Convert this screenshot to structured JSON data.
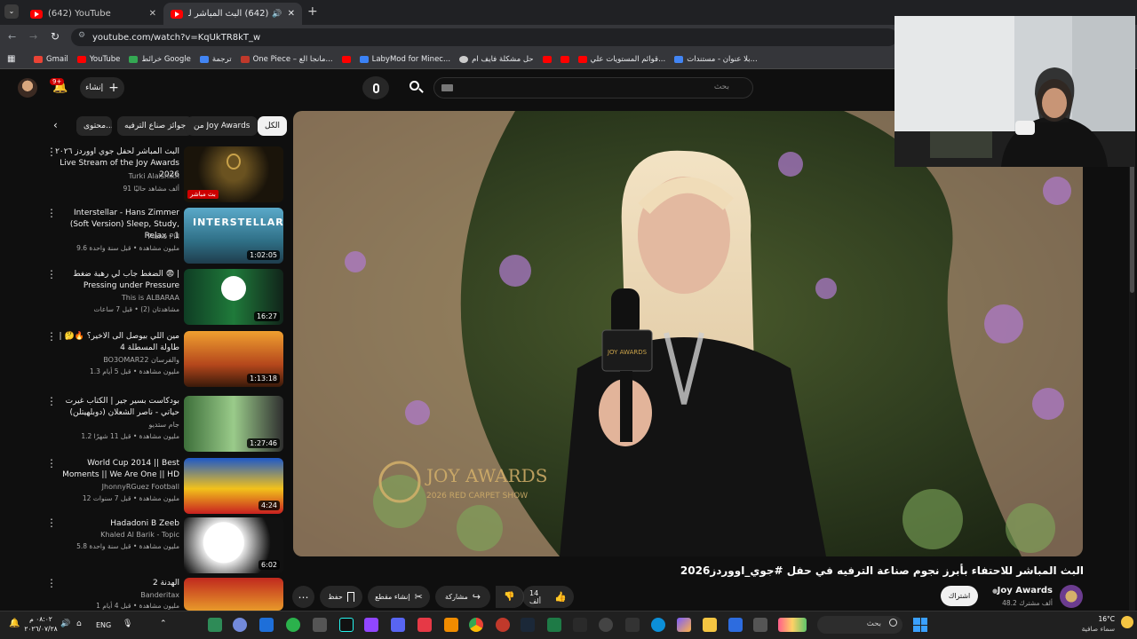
{
  "browser": {
    "tabs": [
      {
        "title": "(642) YouTube"
      },
      {
        "title": "(642) البث المباشر للاحتفاء بأ..."
      }
    ],
    "url": "youtube.com/watch?v=KqUkTR8kT_w",
    "bookmarks": [
      {
        "label": "Gmail",
        "color": "#ea4335"
      },
      {
        "label": "YouTube",
        "color": "#ff0000"
      },
      {
        "label": "خرائط Google",
        "color": "#34a853"
      },
      {
        "label": "ترجمة",
        "color": "#4285f4"
      },
      {
        "label": "One Piece – مانجا الع...",
        "color": "#c0392b"
      },
      {
        "label": "",
        "color": "#ff0000"
      },
      {
        "label": "LabyMod for Minec...",
        "color": "#3b82f6"
      },
      {
        "label": "حل مشكلة فايف ام",
        "color": "#cccccc"
      },
      {
        "label": "",
        "color": "#ff0000"
      },
      {
        "label": "",
        "color": "#ff0000"
      },
      {
        "label": "قوائم المستويات علي...",
        "color": "#ff0000"
      },
      {
        "label": "بلا عنوان - مستندات...",
        "color": "#4285f4"
      }
    ]
  },
  "header": {
    "create_label": "إنشاء",
    "notif_count": "9+",
    "search_placeholder": "بحث"
  },
  "chips": [
    "الكل",
    "من Joy Awards",
    "جوائز صناع الترفيه",
    "محتوى..."
  ],
  "recommendations": [
    {
      "title": "البث المباشر لحفل جوي اووردز ٢٠٢٦ Live Stream of the Joy Awards 2026",
      "channel": "Turki Alalshikh",
      "meta": "91 ألف مشاهد حاليًا",
      "duration": "",
      "badge": "بث مباشر"
    },
    {
      "title": "Interstellar - Hans Zimmer (Soft Version) Sleep, Study, Relax - 1",
      "channel": "Piano Pill",
      "meta": "9.6 مليون مشاهدة • قبل سنة واحدة",
      "duration": "1:02:05",
      "badge": ""
    },
    {
      "title": "الضغط جاب لي رهبة ضغط 😨 | Pressing under Pressure",
      "channel": "This is ALBARAA",
      "meta": "مشاهدتان (2) • قبل 7 ساعات",
      "duration": "16:27",
      "badge": ""
    },
    {
      "title": "مين اللي بيوصل الى الاخير؟ 🔥🤔 | طاولة المسطلة 4",
      "channel": "BO3OMAR22 والفرسان",
      "meta": "1.3 مليون مشاهدة • قبل 5 أيام",
      "duration": "1:13:18",
      "badge": ""
    },
    {
      "title": "بودكاست بسير جير | الكتاب غيرت حياتي - ناصر الشعلان (دوبلهيتلن)",
      "channel": "جام ستديو",
      "meta": "1.2 مليون مشاهدة • قبل 11 شهرًا",
      "duration": "1:27:46",
      "badge": ""
    },
    {
      "title": "World Cup 2014 || Best Moments || We Are One || HD",
      "channel": "JhonnyRGuez Football",
      "meta": "12 مليون مشاهدة • قبل 7 سنوات",
      "duration": "4:24",
      "badge": ""
    },
    {
      "title": "Hadadoni B Zeeb",
      "channel": "Khaled Al Barik - Topic",
      "meta": "5.8 مليون مشاهدة • قبل سنة واحدة",
      "duration": "6:02",
      "badge": ""
    },
    {
      "title": "الهدنة 2",
      "channel": "Banderitax",
      "meta": "1 مليون مشاهدة • قبل 4 أيام",
      "duration": "",
      "badge": ""
    }
  ],
  "video": {
    "watermark_title": "JOY AWARDS",
    "watermark_sub": "2026 RED CARPET SHOW",
    "mic_flag": "JOY AWARDS",
    "title": "البث المباشر للاحتفاء بأبرز نجوم صناعة الترفيه في حفل #جوي_اووردز2026",
    "channel": "Joy Awards",
    "subscribers": "48.2 ألف مشترك",
    "subscribe_label": "اشتراك",
    "like_count": "14 ألف",
    "share_label": "مشاركة",
    "clip_label": "إنشاء مقطع",
    "save_label": "حفظ"
  },
  "taskbar": {
    "time": "٠٨:٠٢ م",
    "date": "٢٠٢٦/٠٧/٢٨",
    "lang": "ENG",
    "search_label": "بحث",
    "weather_temp": "16°C",
    "weather_text": "سماء صافية"
  }
}
